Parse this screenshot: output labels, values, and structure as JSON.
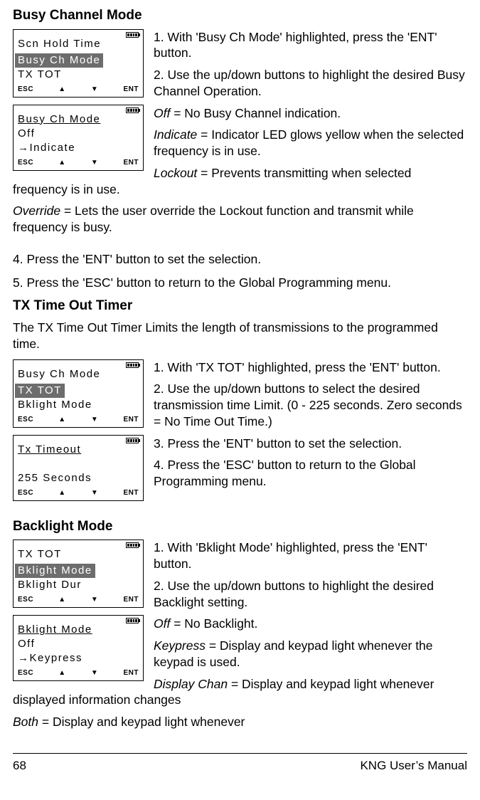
{
  "section1": {
    "title": "Busy Channel Mode",
    "lcd1": {
      "l1": "Scn Hold Time",
      "l2": "Busy Ch Mode",
      "l3": "TX TOT",
      "sk1": "ESC",
      "sk2": "▲",
      "sk3": "▼",
      "sk4": "ENT"
    },
    "lcd2": {
      "l1": "Busy Ch Mode",
      "l2": "   Off",
      "l3": "→Indicate",
      "sk1": "ESC",
      "sk2": "▲",
      "sk3": "▼",
      "sk4": "ENT"
    },
    "p1a": "1.   With 'Busy Ch Mode' highlighted, press the 'ENT' button.",
    "p2": "2.   Use the up/down buttons to highlight the desired Busy Channel Operation.",
    "opt_off_l": "Off",
    "opt_off_t": " = No Busy Channel indication.",
    "opt_ind_l": "Indicate",
    "opt_ind_t": " = Indicator LED glows yellow when the selected frequency is in use.",
    "opt_lock_l": "Lockout",
    "opt_lock_t": " = Prevents transmitting when selected frequency is in use.",
    "opt_ovr_l": "Override",
    "opt_ovr_t": " = Lets the user override the Lockout function and transmit while frequency is busy.",
    "p4": "4.   Press the 'ENT' button to set the selection.",
    "p5": "5.   Press the 'ESC' button to return to the Global Programming menu."
  },
  "section2": {
    "title": "TX Time Out Timer",
    "intro": "The TX Time Out Timer Limits the length of transmissions to the programmed time.",
    "lcd1": {
      "l1": "Busy Ch Mode",
      "l2": "TX TOT",
      "l3": "Bklight Mode",
      "sk1": "ESC",
      "sk2": "▲",
      "sk3": "▼",
      "sk4": "ENT"
    },
    "lcd2": {
      "l1": "Tx Timeout",
      "l2": " ",
      "l3": "255 Seconds",
      "sk1": "ESC",
      "sk2": "▲",
      "sk3": "▼",
      "sk4": "ENT"
    },
    "p1": "1.  With 'TX TOT' highlighted, press the 'ENT' button.",
    "p2": "2.   Use the up/down buttons to select the desired transmission time Limit. (0 - 225 seconds. Zero seconds = No Time Out Time.)",
    "p3": "3.   Press the 'ENT' button to set the selection.",
    "p4": "4.   Press the 'ESC' button to return to the Global Programming menu."
  },
  "section3": {
    "title": "Backlight Mode",
    "lcd1": {
      "l1": "TX TOT",
      "l2": "Bklight Mode",
      "l3": "Bklight Dur",
      "sk1": "ESC",
      "sk2": "▲",
      "sk3": "▼",
      "sk4": "ENT"
    },
    "lcd2": {
      "l1": "Bklight Mode",
      "l2": "   Off",
      "l3": "→Keypress",
      "sk1": "ESC",
      "sk2": "▲",
      "sk3": "▼",
      "sk4": "ENT"
    },
    "p1": "1.  With 'Bklight Mode' highlighted, press the 'ENT' button.",
    "p2": "2.   Use the up/down buttons to highlight the desired Backlight setting.",
    "opt_off_l": "Off",
    "opt_off_t": " = No Backlight.",
    "opt_kp_l": "Keypress",
    "opt_kp_t": " = Display and keypad light whenever the keypad is used.",
    "opt_dc_l": "Display Chan",
    "opt_dc_t": " = Display and keypad light whenever displayed information changes",
    "opt_both_l": "Both",
    "opt_both_t": " = Display and keypad light whenever"
  },
  "footer": {
    "page": "68",
    "label": "KNG User’s Manual"
  }
}
